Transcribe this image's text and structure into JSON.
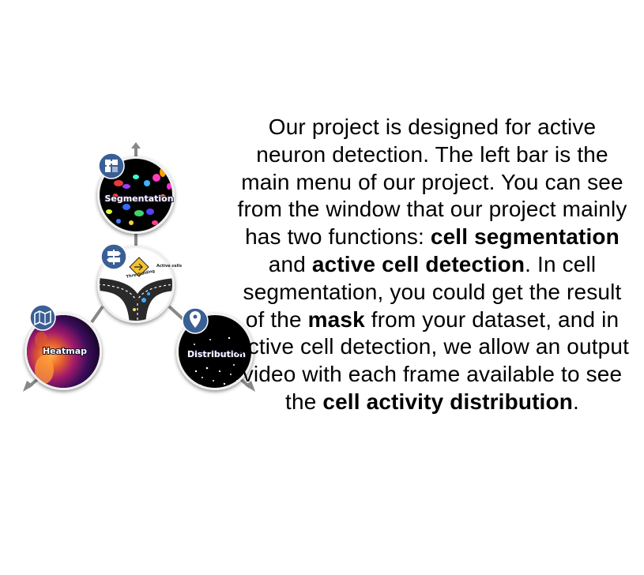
{
  "diagram": {
    "nodes": {
      "segmentation": {
        "label": "Segmentation",
        "icon": "puzzle-icon"
      },
      "thresholding": {
        "label": "Thresholding",
        "sign_text": "Active cells",
        "icon": "signpost-icon"
      },
      "heatmap": {
        "label": "Heatmap",
        "icon": "map-icon"
      },
      "distribution": {
        "label": "Distribution",
        "icon": "location-pin-icon"
      }
    },
    "colors": {
      "icon_badge": "#3a5f95",
      "connector": "#888888",
      "node_bg": "#000000"
    }
  },
  "description": [
    {
      "text": "Our project is designed for active neuron detection. The left bar is the main menu of our project. You can see from the window that our project mainly has two functions: ",
      "bold": false
    },
    {
      "text": "cell segmentation",
      "bold": true
    },
    {
      "text": " and ",
      "bold": false
    },
    {
      "text": "active cell detection",
      "bold": true
    },
    {
      "text": ". In cell segmentation, you could get the result of the ",
      "bold": false
    },
    {
      "text": "mask",
      "bold": true
    },
    {
      "text": " from your dataset, and in active cell detection, we allow an output video with each frame available to see the ",
      "bold": false
    },
    {
      "text": "cell activity distribution",
      "bold": true
    },
    {
      "text": ".",
      "bold": false
    }
  ]
}
